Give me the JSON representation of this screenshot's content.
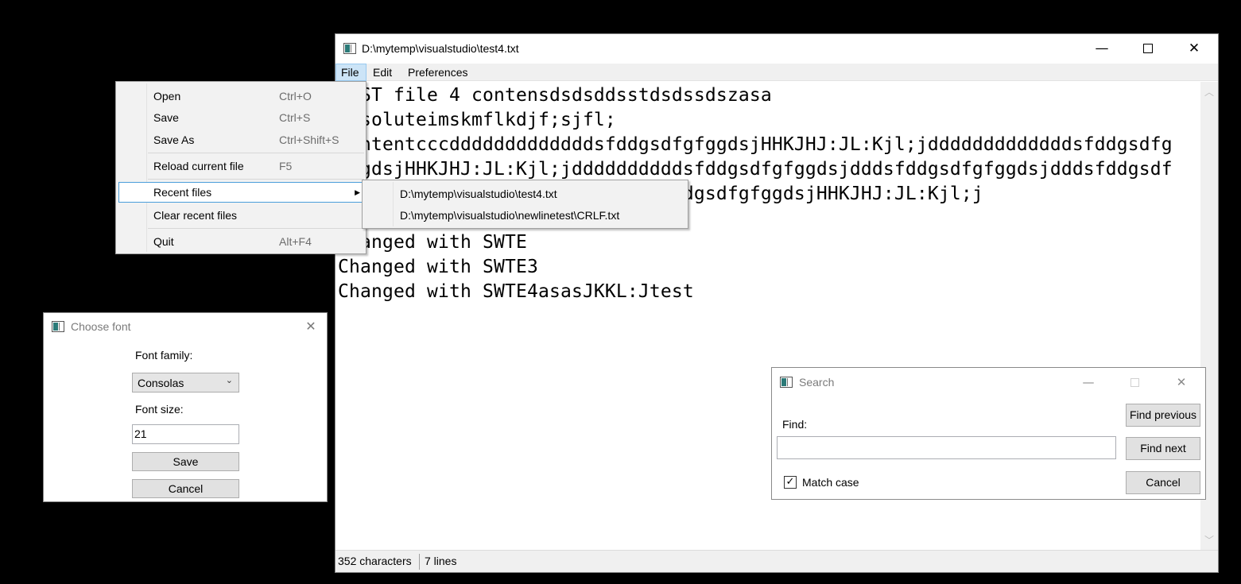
{
  "main_window": {
    "title": "D:\\mytemp\\visualstudio\\test4.txt",
    "caption": {
      "minimize": "—",
      "close": "✕"
    },
    "menubar": [
      "File",
      "Edit",
      "Preferences"
    ],
    "editor_lines": [
      "TEST file 4 contensdsdsddsstdsdssdszasa",
      "absoluteimskmflkdjf;sjfl;",
      "contentcccdddddddddddddsfddgsdfgfggdsjHHKJHJ:JL:Kjl;jdddddddddddddsfddgsdfg",
      "fggdsjHHKJHJ:JL:Kjl;jddddddddddsfddgsdfgfggdsjdddsfddgsdfgfggdsjdddsfddgsdf",
      "gfggdsjdddsfddgsdfgfggdsjdddsfddgsdfgfggdsjHHKJHJ:JL:Kjl;j",
      "",
      "Changed with SWTE",
      "Changed with SWTE3",
      "Changed with SWTE4asasJKKL:Jtest"
    ],
    "status": {
      "characters": "352 characters",
      "lines": "7 lines"
    }
  },
  "file_menu": {
    "items": [
      {
        "label": "Open",
        "shortcut": "Ctrl+O"
      },
      {
        "label": "Save",
        "shortcut": "Ctrl+S"
      },
      {
        "label": "Save As",
        "shortcut": "Ctrl+Shift+S"
      },
      {
        "label": "Reload current file",
        "shortcut": "F5"
      },
      {
        "label": "Recent files",
        "shortcut": ""
      },
      {
        "label": "Clear recent files",
        "shortcut": ""
      },
      {
        "label": "Quit",
        "shortcut": "Alt+F4"
      }
    ],
    "submenu_arrow": "▶"
  },
  "recent_files": [
    "D:\\mytemp\\visualstudio\\test4.txt",
    "D:\\mytemp\\visualstudio\\newlinetest\\CRLF.txt"
  ],
  "font_dialog": {
    "title": "Choose font",
    "close": "✕",
    "family_label": "Font family:",
    "family_value": "Consolas",
    "chevron": "⌄",
    "size_label": "Font size:",
    "size_value": "21",
    "save": "Save",
    "cancel": "Cancel"
  },
  "search_dialog": {
    "title": "Search",
    "minimize": "—",
    "close": "✕",
    "find_label": "Find:",
    "find_value": "",
    "match_case_label": "Match case",
    "match_case_checked": true,
    "check_mark": "✓",
    "find_previous": "Find previous",
    "find_next": "Find next",
    "cancel": "Cancel"
  }
}
